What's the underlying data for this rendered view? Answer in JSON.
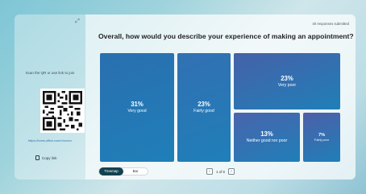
{
  "side": {
    "scan_text": "Scan the QR or use link to join",
    "url": "https://forms.office.com/r/xxxxxx",
    "copy_label": "Copy link"
  },
  "main": {
    "responses": "40 responses submitted",
    "question": "Overall, how would you describe your experience of making an appointment?",
    "tiles": [
      {
        "pct": "31%",
        "label": "Very good",
        "color": "#2a6fb0"
      },
      {
        "pct": "23%",
        "label": "Fairly good",
        "color": "#3270b3"
      },
      {
        "pct": "23%",
        "label": "Very poor",
        "color": "#4661a8"
      },
      {
        "pct": "13%",
        "label": "Neither good nor poor",
        "color": "#4a64ac"
      },
      {
        "pct": "7%",
        "label": "Fairly poor",
        "color": "#4d5fa8"
      }
    ]
  },
  "footer": {
    "toggle": [
      "Treemap",
      "Bar"
    ],
    "page": "1 of 6"
  }
}
